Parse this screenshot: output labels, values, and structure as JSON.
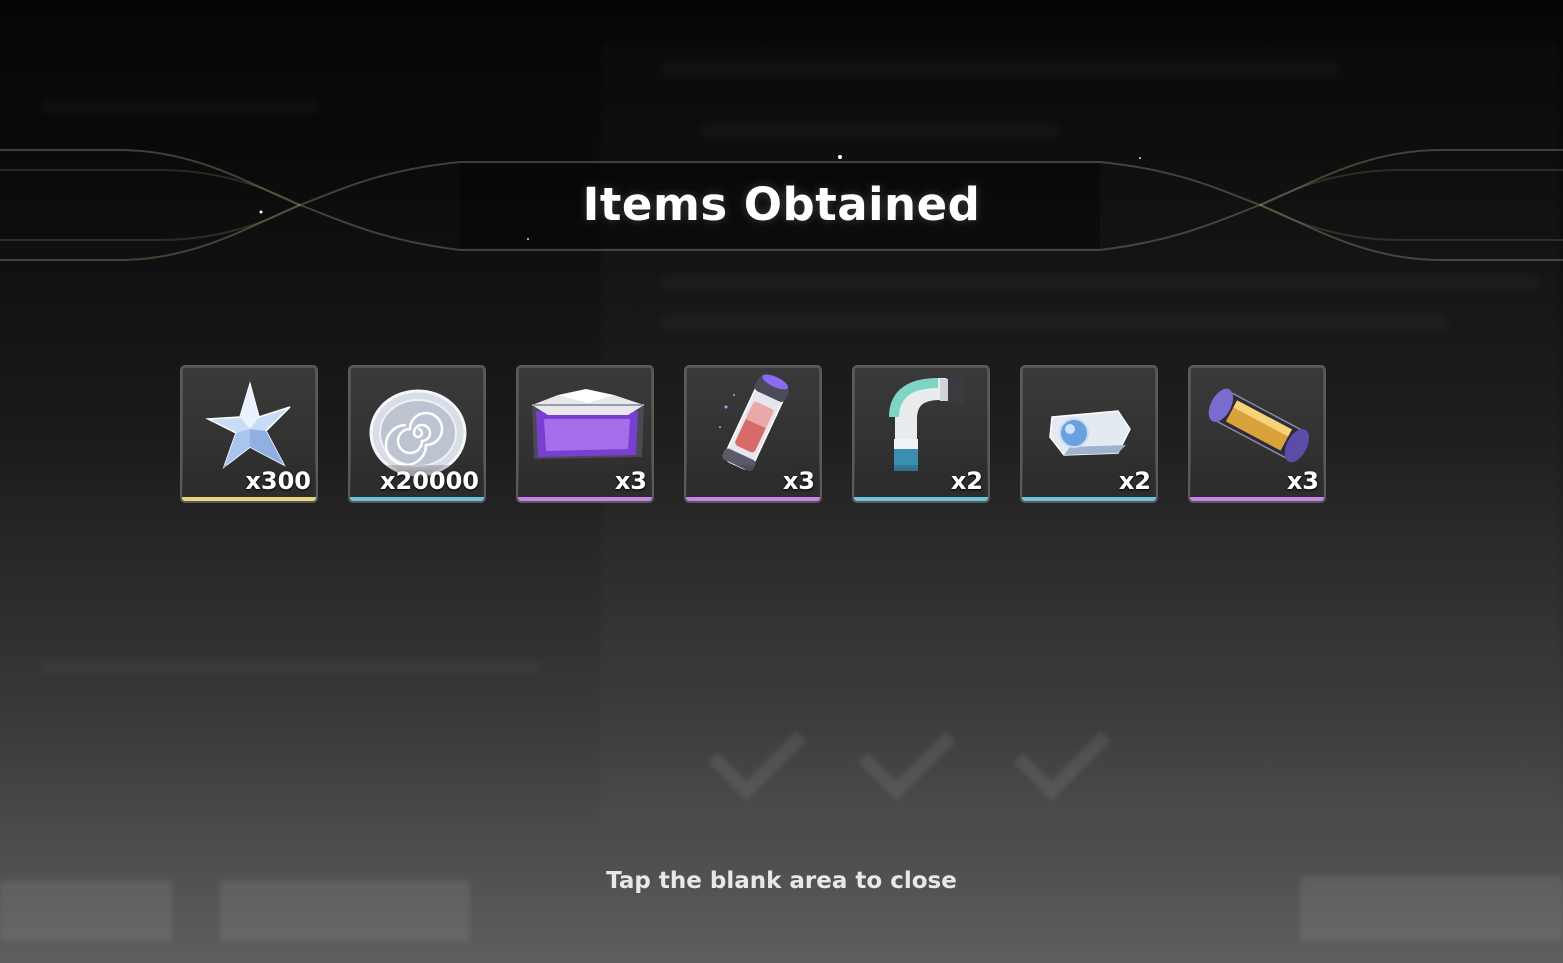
{
  "title": "Items Obtained",
  "hint": "Tap the blank area to close",
  "items": [
    {
      "icon": "star-crystal-icon",
      "count": "x300",
      "rarity_color": "#e8d77a"
    },
    {
      "icon": "silver-coin-icon",
      "count": "x20000",
      "rarity_color": "#6fc3d9"
    },
    {
      "icon": "purple-crate-icon",
      "count": "x3",
      "rarity_color": "#c784e8"
    },
    {
      "icon": "purple-vial-icon",
      "count": "x3",
      "rarity_color": "#c784e8"
    },
    {
      "icon": "teal-pipe-icon",
      "count": "x2",
      "rarity_color": "#6fc3d9"
    },
    {
      "icon": "blue-chip-icon",
      "count": "x2",
      "rarity_color": "#6fc3d9"
    },
    {
      "icon": "gold-capsule-icon",
      "count": "x3",
      "rarity_color": "#c784e8"
    }
  ]
}
